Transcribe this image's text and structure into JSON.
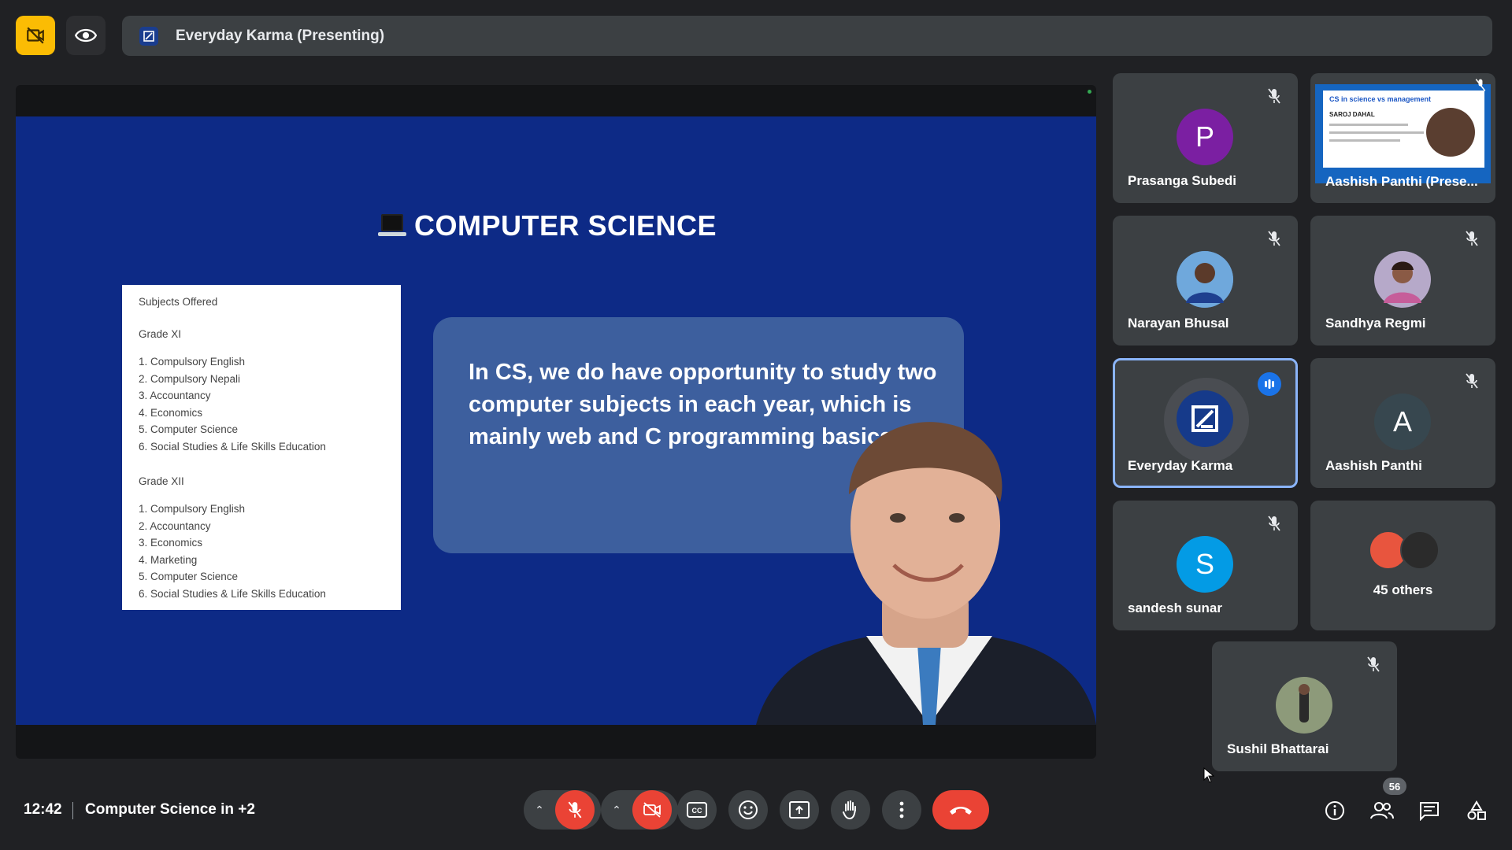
{
  "topbar": {
    "presenting_title": "Everyday Karma (Presenting)"
  },
  "slide": {
    "title": "COMPUTER SCIENCE",
    "subjects_heading": "Subjects Offered",
    "grade11_label": "Grade XI",
    "grade11_subjects": [
      "1. Compulsory English",
      "2. Compulsory Nepali",
      "3. Accountancy",
      "4. Economics",
      "5. Computer Science",
      "6. Social Studies & Life Skills Education"
    ],
    "grade12_label": "Grade XII",
    "grade12_subjects": [
      "1. Compulsory English",
      "2. Accountancy",
      "3. Economics",
      "4. Marketing",
      "5. Computer Science",
      "6. Social Studies & Life Skills Education"
    ],
    "quote": "In CS, we do have opportunity to study two computer subjects in each year, which is mainly  web and C programming basics"
  },
  "participants": {
    "p1": {
      "name": "Prasanga Subedi",
      "initial": "P",
      "color": "#7b1fa2"
    },
    "p2": {
      "name": "Aashish Panthi (Prese...",
      "screen_title": "CS in science vs management",
      "screen_subtitle": "SAROJ DAHAL"
    },
    "p3": {
      "name": "Narayan Bhusal"
    },
    "p4": {
      "name": "Sandhya Regmi"
    },
    "p5": {
      "name": "Everyday Karma"
    },
    "p6": {
      "name": "Aashish Panthi",
      "initial": "A",
      "color": "#37474f"
    },
    "p7": {
      "name": "sandesh sunar",
      "initial": "S",
      "color": "#039be5"
    },
    "others": {
      "label": "45 others"
    },
    "p8": {
      "name": "Sushil Bhattarai"
    }
  },
  "bottombar": {
    "time": "12:42",
    "meeting_title": "Computer Science in +2",
    "people_count": "56"
  }
}
